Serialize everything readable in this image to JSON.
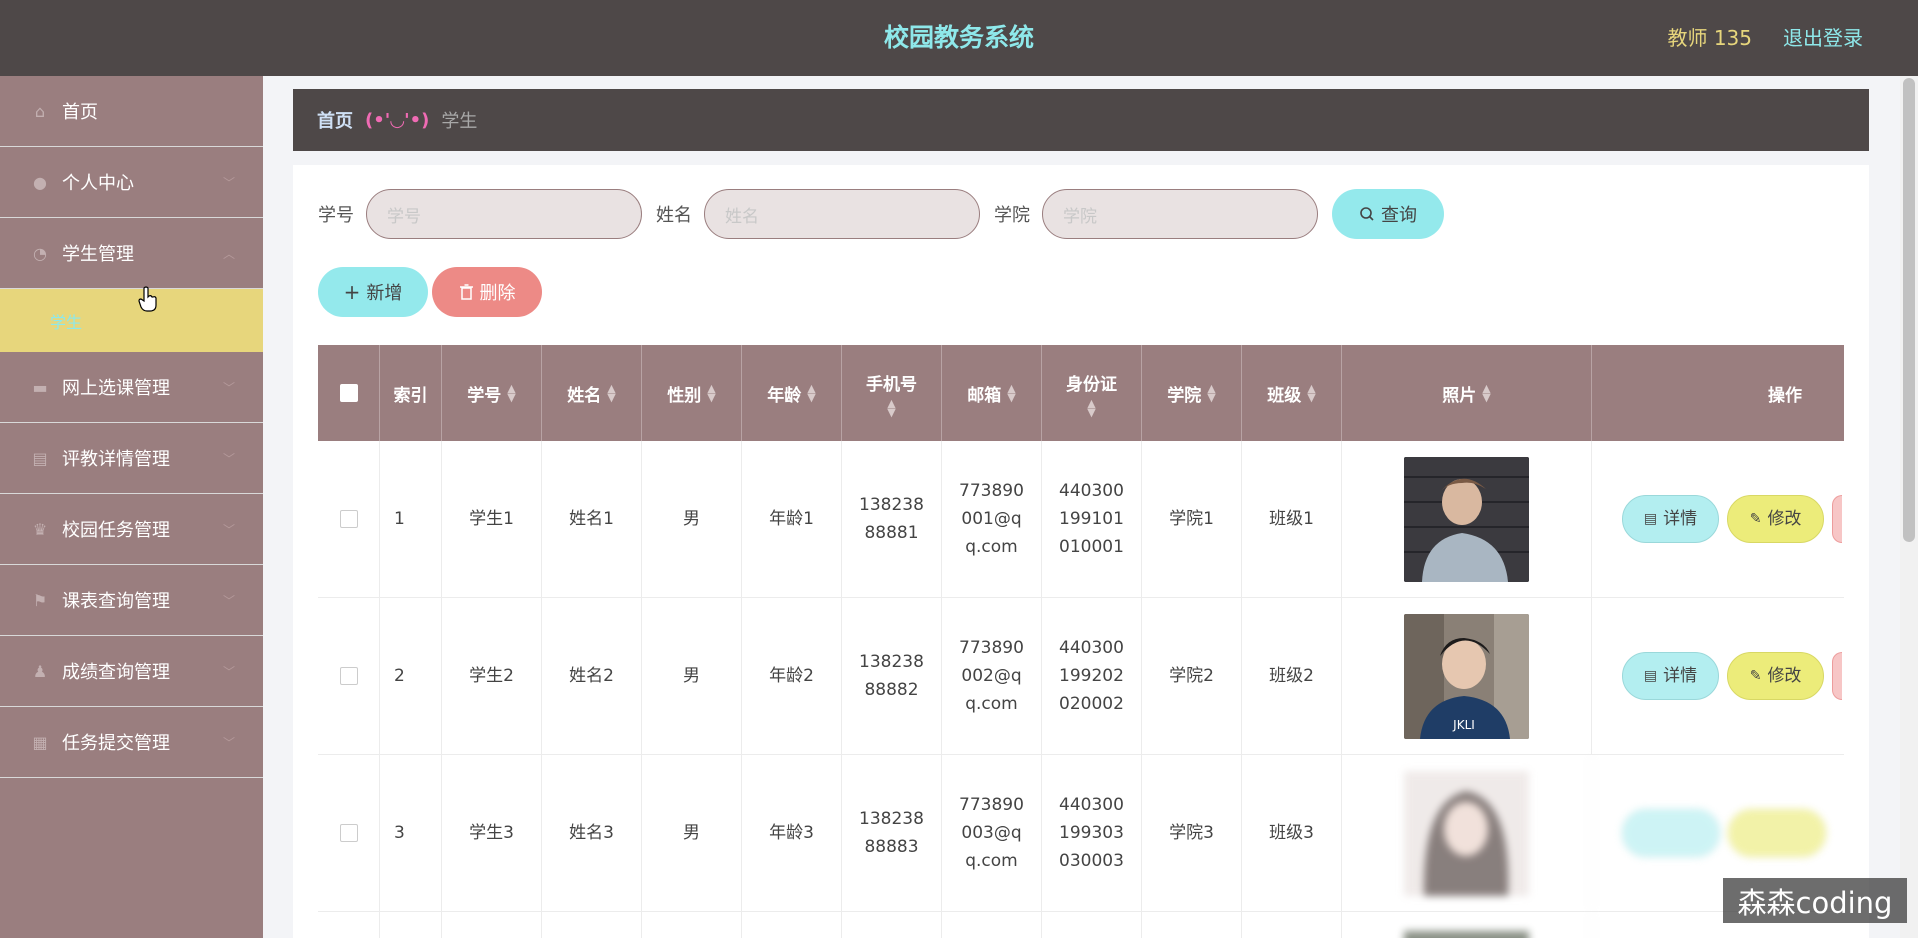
{
  "header": {
    "title": "校园教务系统",
    "user": "教师 135",
    "logout": "退出登录"
  },
  "sidebar": {
    "items": [
      {
        "label": "首页",
        "icon": "home-icon"
      },
      {
        "label": "个人中心",
        "icon": "user-icon"
      },
      {
        "label": "学生管理",
        "icon": "clock-icon",
        "expanded": true
      },
      {
        "label": "网上选课管理",
        "icon": "keyboard-icon"
      },
      {
        "label": "评教详情管理",
        "icon": "comment-icon"
      },
      {
        "label": "校园任务管理",
        "icon": "trophy-icon"
      },
      {
        "label": "课表查询管理",
        "icon": "flag-icon"
      },
      {
        "label": "成绩查询管理",
        "icon": "person-icon"
      },
      {
        "label": "任务提交管理",
        "icon": "grid-icon"
      }
    ],
    "submenu": "学生"
  },
  "breadcrumb": {
    "home": "首页",
    "separator": "(•'◡'•)",
    "current": "学生"
  },
  "search": {
    "student_id_label": "学号",
    "student_id_placeholder": "学号",
    "name_label": "姓名",
    "name_placeholder": "姓名",
    "college_label": "学院",
    "college_placeholder": "学院",
    "query_button": "查询"
  },
  "actions": {
    "add": "新增",
    "delete": "删除"
  },
  "table": {
    "headers": [
      "索引",
      "学号",
      "姓名",
      "性别",
      "年龄",
      "手机号",
      "邮箱",
      "身份证",
      "学院",
      "班级",
      "照片",
      "操作"
    ],
    "rows": [
      {
        "index": "1",
        "id": "学生1",
        "name": "姓名1",
        "gender": "男",
        "age": "年龄1",
        "phone": "13823888881",
        "email": "773890001@qq.com",
        "idcard": "440300199101010001",
        "college": "学院1",
        "class": "班级1"
      },
      {
        "index": "2",
        "id": "学生2",
        "name": "姓名2",
        "gender": "男",
        "age": "年龄2",
        "phone": "13823888882",
        "email": "773890002@qq.com",
        "idcard": "440300199202020002",
        "college": "学院2",
        "class": "班级2"
      },
      {
        "index": "3",
        "id": "学生3",
        "name": "姓名3",
        "gender": "男",
        "age": "年龄3",
        "phone": "13823888883",
        "email": "773890003@qq.com",
        "idcard": "440300199303030003",
        "college": "学院3",
        "class": "班级3"
      }
    ],
    "detail_button": "详情",
    "edit_button": "修改"
  },
  "watermark": "森森coding",
  "colors": {
    "header_bg": "#4e4848",
    "sidebar_bg": "#9a7e7f",
    "accent_cyan": "#94e9ec",
    "accent_yellow": "#e7d67c",
    "danger": "#ed8a86"
  }
}
